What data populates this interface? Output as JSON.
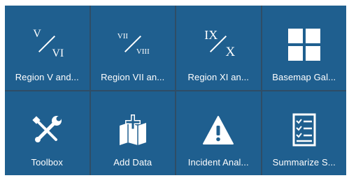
{
  "panel": {
    "tiles": [
      {
        "label": "Region V and...",
        "icon": "fraction-v-vi-icon",
        "numerator": "V",
        "denominator": "VI"
      },
      {
        "label": "Region VII an...",
        "icon": "fraction-vii-viii-icon",
        "numerator": "VII",
        "denominator": "VIII"
      },
      {
        "label": "Region XI an...",
        "icon": "fraction-ix-x-icon",
        "numerator": "IX",
        "denominator": "X"
      },
      {
        "label": "Basemap Gal...",
        "icon": "grid-icon"
      },
      {
        "label": "Toolbox",
        "icon": "wrench-screwdriver-icon"
      },
      {
        "label": "Add Data",
        "icon": "add-data-map-icon"
      },
      {
        "label": "Incident Anal...",
        "icon": "warning-icon"
      },
      {
        "label": "Summarize S...",
        "icon": "checklist-icon"
      }
    ]
  },
  "colors": {
    "tile_background": "#1f5f8f",
    "panel_divider": "#2f4d66",
    "icon_foreground": "#ffffff"
  }
}
